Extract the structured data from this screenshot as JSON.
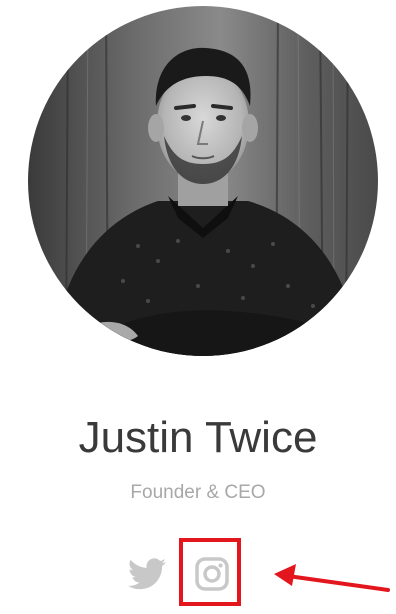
{
  "profile": {
    "name": "Justin Twice",
    "role": "Founder & CEO"
  },
  "social": {
    "icons": [
      "twitter-icon",
      "instagram-icon"
    ]
  },
  "colors": {
    "name_text": "#3a3a3a",
    "role_text": "#a8a8a8",
    "icon_grey": "#c8c8c8",
    "annotation_red": "#e4161d"
  }
}
